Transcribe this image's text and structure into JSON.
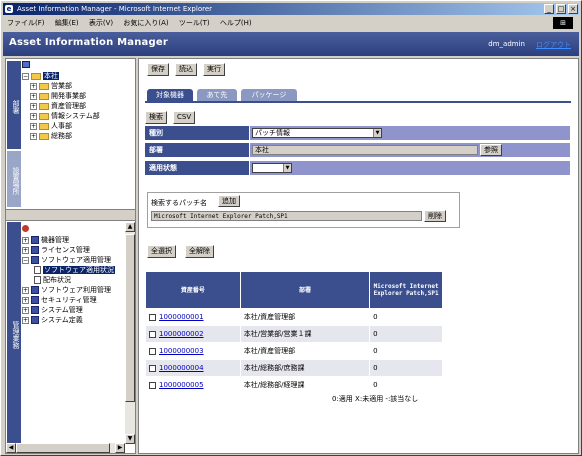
{
  "window": {
    "title": "Asset Information Manager - Microsoft Internet Explorer"
  },
  "menu": [
    "ファイル(F)",
    "編集(E)",
    "表示(V)",
    "お気に入り(A)",
    "ツール(T)",
    "ヘルプ(H)"
  ],
  "app": {
    "title": "Asset Information Manager",
    "user": "dm_admin",
    "logout": "ログアウト"
  },
  "left_tabs": {
    "top": "部署",
    "middle": "設置場所",
    "bottom": "管理業務"
  },
  "org_tree": {
    "root": "本社",
    "children": [
      "営業部",
      "開発事業部",
      "資産管理部",
      "情報システム部",
      "人事部",
      "総務部"
    ]
  },
  "task_tree": {
    "items": [
      "機器管理",
      "ライセンス管理",
      "ソフトウェア適用管理",
      "ソフトウェア適用状況",
      "配布状況",
      "ソフトウェア利用管理",
      "セキュリティ管理",
      "システム管理",
      "システム定義"
    ]
  },
  "toolbar": {
    "save": "保存",
    "load": "読込",
    "run": "実行"
  },
  "tabs": [
    "対象機器",
    "あて先",
    "パッケージ"
  ],
  "actions": {
    "search": "検索",
    "csv": "CSV"
  },
  "form": {
    "type_label": "種別",
    "type_value": "パッチ情報",
    "dept_label": "部署",
    "dept_value": "本社",
    "ref_button": "参照",
    "status_label": "適用状態",
    "status_value": ""
  },
  "patch": {
    "label": "検索するパッチ名",
    "add": "追加",
    "value": "Microsoft Internet Explorer Patch,SP1",
    "delete": "削除"
  },
  "select_buttons": {
    "all": "全選択",
    "none": "全解除"
  },
  "table": {
    "headers": [
      "資産番号",
      "部署",
      "Microsoft Internet Explorer Patch,SP1"
    ],
    "rows": [
      {
        "id": "1000000001",
        "dept": "本社/資産管理部",
        "val": "0"
      },
      {
        "id": "1000000002",
        "dept": "本社/営業部/営業１課",
        "val": "0"
      },
      {
        "id": "1000000003",
        "dept": "本社/資産管理部",
        "val": "0"
      },
      {
        "id": "1000000004",
        "dept": "本社/総務部/庶務課",
        "val": "0"
      },
      {
        "id": "1000000005",
        "dept": "本社/総務部/経理課",
        "val": "0"
      }
    ]
  },
  "legend": "0:適用 X:未適用 -:該当なし",
  "colors": {
    "accent": "#3b4f8f",
    "field_bg": "#8f95cc",
    "title_gradient_start": "#0a246a"
  }
}
